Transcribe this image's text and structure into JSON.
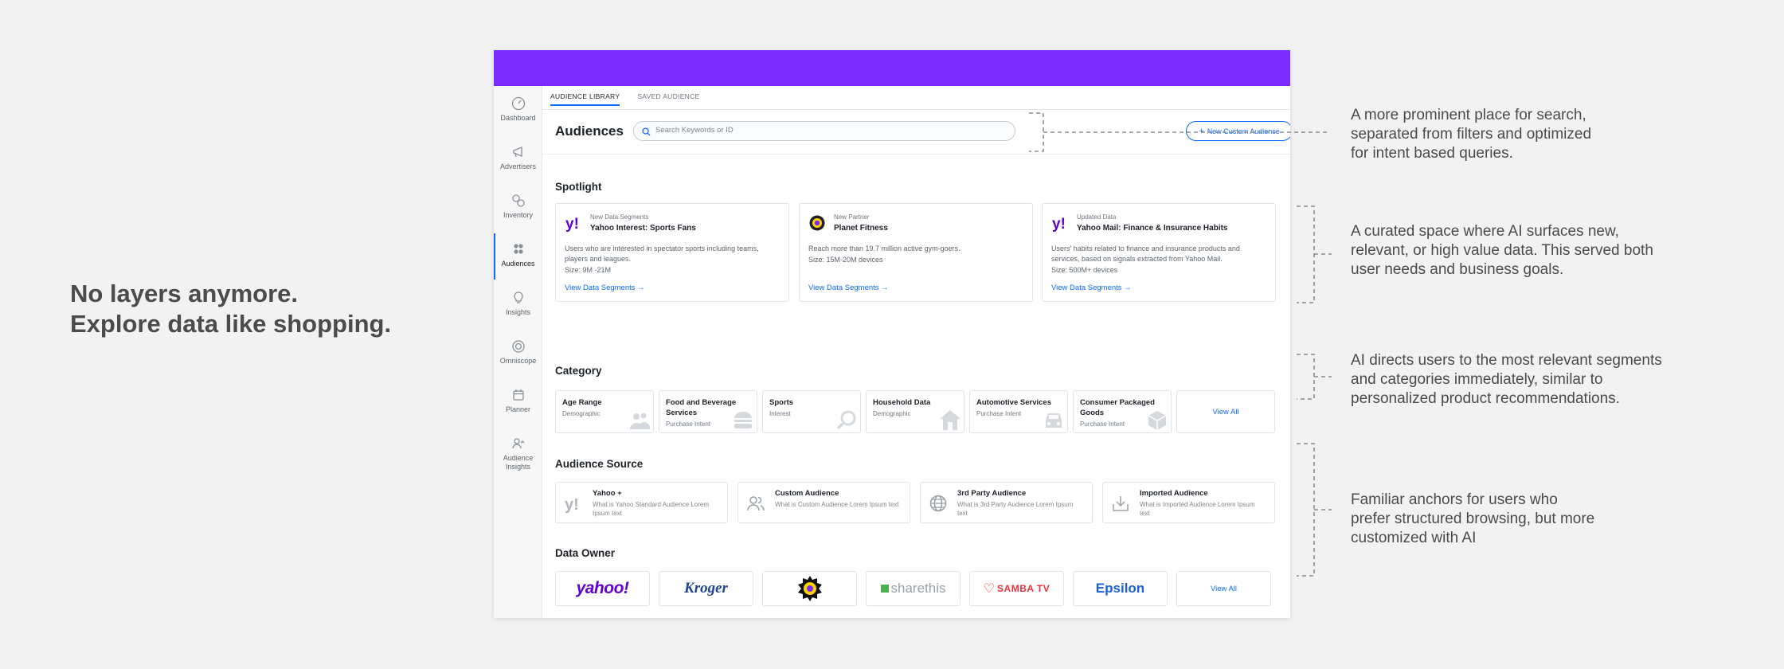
{
  "headline": [
    "No layers anymore.",
    "Explore data like shopping."
  ],
  "nav": [
    {
      "label": "Dashboard",
      "icon": "dashboard-icon"
    },
    {
      "label": "Advertisers",
      "icon": "advertisers-icon"
    },
    {
      "label": "Inventory",
      "icon": "inventory-icon"
    },
    {
      "label": "Audiences",
      "icon": "audiences-icon",
      "active": true
    },
    {
      "label": "Insights",
      "icon": "insights-icon"
    },
    {
      "label": "Omniscope",
      "icon": "omniscope-icon"
    },
    {
      "label": "Planner",
      "icon": "planner-icon"
    },
    {
      "label": "Audience Insights",
      "icon": "audience-insights-icon"
    }
  ],
  "tabs": [
    "AUDIENCE LIBRARY",
    "SAVED AUDIENCE"
  ],
  "page_title": "Audiences",
  "search": {
    "placeholder": "Search Keywords or ID"
  },
  "new_button": "New Custom Audience",
  "spotlight": {
    "title": "Spotlight",
    "cards": [
      {
        "kicker": "New Data Segments",
        "name": "Yahoo Interest: Sports Fans",
        "desc": "Users who are interested in spectator sports including teams, players and leagues.",
        "size": "Size: 9M -21M",
        "link": "View Data Segments →"
      },
      {
        "kicker": "New Partner",
        "name": "Planet Fitness",
        "desc": "Reach more than 19.7 million active gym-goers.",
        "size": "Size: 15M-20M devices",
        "link": "View Data Segments →"
      },
      {
        "kicker": "Updated Data",
        "name": "Yahoo Mail: Finance & Insurance Habits",
        "desc": "Users' habits related to finance and insurance products and services, based on signals extracted from Yahoo Mail.",
        "size": "Size: 500M+ devices",
        "link": "View Data Segments →"
      }
    ]
  },
  "category": {
    "title": "Category",
    "items": [
      {
        "name": "Age Range",
        "sub": "Demographic",
        "icon": "people-icon"
      },
      {
        "name": "Food and Beverage Services",
        "sub": "Purchase Intent",
        "icon": "burger-icon"
      },
      {
        "name": "Sports",
        "sub": "Interest",
        "icon": "tennis-racket-icon"
      },
      {
        "name": "Household Data",
        "sub": "Demographic",
        "icon": "house-icon"
      },
      {
        "name": "Automotive Services",
        "sub": "Purchase Intent",
        "icon": "car-icon"
      },
      {
        "name": "Consumer Packaged Goods",
        "sub": "Purchase Intent",
        "icon": "box-icon"
      }
    ],
    "view_all": "View All"
  },
  "source": {
    "title": "Audience Source",
    "items": [
      {
        "name": "Yahoo +",
        "desc": "What is Yahoo Standard Audience Lorem Ipsum text",
        "icon": "yahoo-y-icon"
      },
      {
        "name": "Custom Audience",
        "desc": "What is Custom Audience Lorem Ipsum text",
        "icon": "users-icon"
      },
      {
        "name": "3rd Party Audience",
        "desc": "What is 3rd Party Audience Lorem Ipsum text",
        "icon": "globe-icon"
      },
      {
        "name": "Imported Audience",
        "desc": "What is Imported Audience Lorem Ipsum text",
        "icon": "import-icon"
      }
    ]
  },
  "owner": {
    "title": "Data Owner",
    "logos": {
      "yahoo": "yahoo!",
      "kroger": "Kroger",
      "sharethis": "sharethis",
      "samba": "SAMBA TV",
      "epsilon": "Epsilon"
    },
    "view_all": "View All"
  },
  "colors": {
    "topbar": "#7b2cff",
    "link": "#0f69ff",
    "yahoo": "#6001d2"
  },
  "notes": [
    [
      "A more prominent place for search,",
      "separated from filters and optimized",
      "for intent based queries."
    ],
    [
      "A curated space where AI surfaces new,",
      "relevant, or high value data. This served both",
      "user needs and business goals."
    ],
    [
      "AI directs users to the most relevant segments",
      "and categories immediately, similar to",
      "personalized product recommendations."
    ],
    [
      "Familiar anchors for users who",
      "prefer structured browsing, but more",
      "customized with AI"
    ]
  ]
}
